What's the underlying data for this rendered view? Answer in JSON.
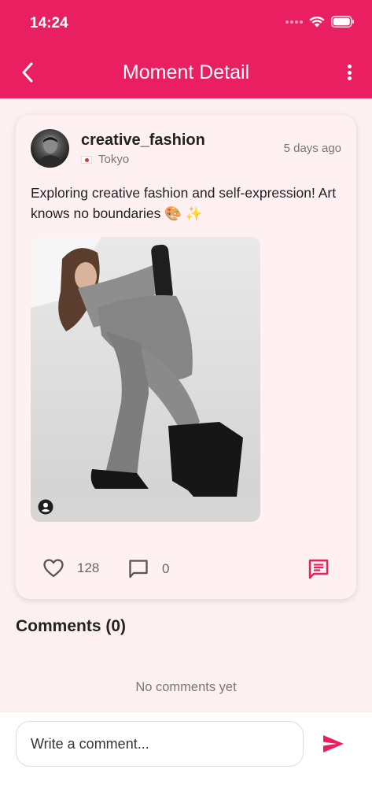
{
  "status_bar": {
    "time": "14:24"
  },
  "header": {
    "title": "Moment Detail"
  },
  "post": {
    "username": "creative_fashion",
    "location": "Tokyo",
    "time_ago": "5 days ago",
    "text": "Exploring creative fashion and self-expression! Art knows no boundaries 🎨 ✨",
    "likes": "128",
    "comments": "0"
  },
  "comments_section": {
    "title": "Comments (0)",
    "empty_text": "No comments yet"
  },
  "composer": {
    "placeholder": "Write a comment..."
  },
  "colors": {
    "accent": "#ea1f62",
    "background": "#fdf0f1",
    "card": "#fff0f1"
  }
}
